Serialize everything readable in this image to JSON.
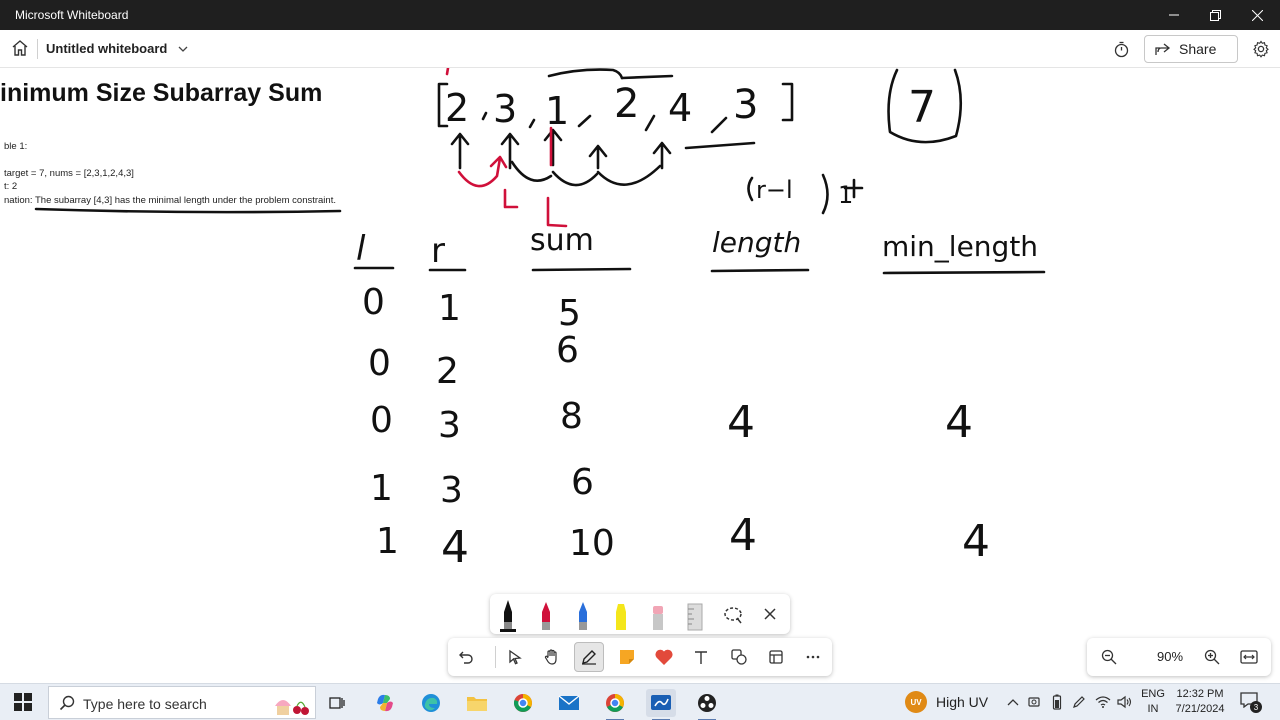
{
  "window": {
    "title": "Microsoft Whiteboard"
  },
  "toolbar": {
    "doc_title": "Untitled whiteboard",
    "share_label": "Share"
  },
  "card": {
    "heading": "inimum Size Subarray Sum",
    "lines": [
      "ble 1:",
      "target = 7, nums = [2,3,1,2,4,3]",
      "t:  2",
      "nation: The subarray [4,3] has the minimal length under the problem constraint."
    ]
  },
  "handwriting": {
    "array": "[2,3,1,2,4,3]",
    "target": "7",
    "formula": "(r-l)+1",
    "pointer_marks": [
      "L",
      "L"
    ],
    "columns": [
      "l",
      "r",
      "sum",
      "length",
      "min_length"
    ],
    "rows": [
      [
        "0",
        "1",
        "5",
        "",
        ""
      ],
      [
        "0",
        "2",
        "6",
        "",
        ""
      ],
      [
        "0",
        "3",
        "8",
        "4",
        "4"
      ],
      [
        "1",
        "3",
        "6",
        "",
        ""
      ],
      [
        "1",
        "4",
        "10",
        "4",
        "4"
      ]
    ]
  },
  "pen_tray": {
    "tools": [
      "pen-black",
      "pen-red",
      "pen-blue",
      "highlighter-yellow",
      "eraser",
      "ruler",
      "lasso-select",
      "close"
    ],
    "colors": {
      "black": "#111111",
      "red": "#d0103a",
      "blue": "#2a6fdb",
      "yellow": "#f4e61a"
    }
  },
  "dock": {
    "tools": [
      "undo",
      "select",
      "pan",
      "inking",
      "sticky-note",
      "reactions",
      "text",
      "shapes",
      "templates",
      "more"
    ]
  },
  "zoom": {
    "value": "90%"
  },
  "taskbar": {
    "search_placeholder": "Type here to search",
    "weather": "High UV",
    "weather_badge": "UV",
    "lang_line1": "ENG",
    "lang_line2": "IN",
    "time": "12:32 PM",
    "date": "7/21/2024",
    "notifications": "3"
  }
}
